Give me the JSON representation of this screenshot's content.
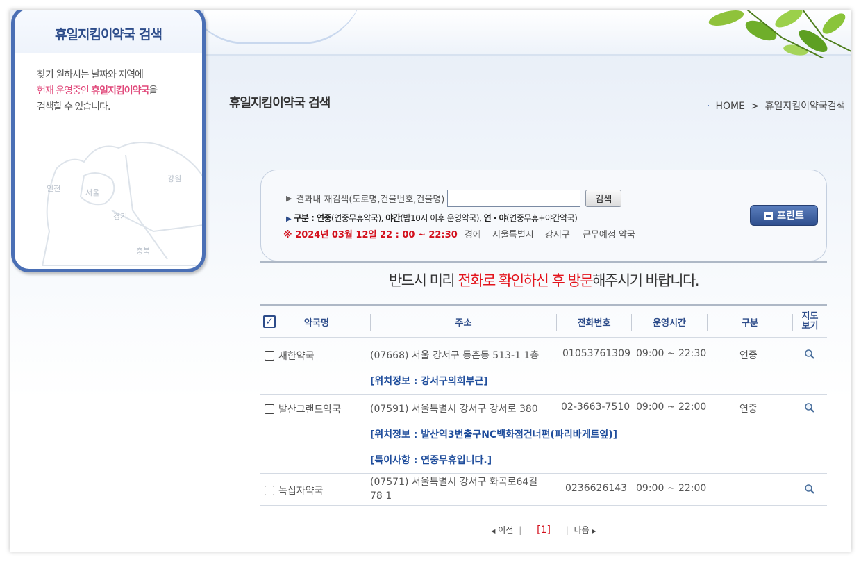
{
  "sidebar": {
    "title": "휴일지킴이약국 검색",
    "desc_line1": "찾기 원하시는 날짜와 지역에",
    "desc_line2_a": "현재 운영중인 ",
    "desc_line2_b": "휴일지킴이약국",
    "desc_line2_c": "을",
    "desc_line3": "검색할 수 있습니다.",
    "map_labels": {
      "incheon": "인천",
      "seoul": "서울",
      "gyeonggi": "경기",
      "gangwon": "강원",
      "chungbuk": "충북"
    }
  },
  "header": {
    "page_title": "휴일지킴이약국 검색",
    "breadcrumb_home": "HOME",
    "breadcrumb_sep": ">",
    "breadcrumb_current": "휴일지킴이약국검색"
  },
  "search": {
    "label": "결과내 재검색(도로명,건물번호,건물명)",
    "input_value": "",
    "button_label": "검색",
    "legend_prefix": "구분 : ",
    "legend_a": "연중",
    "legend_a_desc": "(연중무휴약국), ",
    "legend_b": "야간",
    "legend_b_desc": "(밤10시 이후 운영약국), ",
    "legend_c": "연 · 야",
    "legend_c_desc": "(연중무휴+야간약국)",
    "date_text": "※ 2024년 03월 12일 22 : 00 ~ 22:30",
    "date_suffix": "경에",
    "region_city": "서울특별시",
    "region_district": "강서구",
    "region_suffix": "근무예정 약국",
    "print_label": "프린트"
  },
  "notice": {
    "part1": "반드시 미리 ",
    "part2": "전화로 확인하신 후 방문",
    "part3": "해주시기 바랍니다."
  },
  "table": {
    "headers": {
      "name": "약국명",
      "address": "주소",
      "phone": "전화번호",
      "hours": "운영시간",
      "type": "구분",
      "map_line1": "지도",
      "map_line2": "보기"
    },
    "rows": [
      {
        "name": "새한약국",
        "address": "(07668) 서울 강서구 등촌동 513-1 1층",
        "phone": "01053761309",
        "hours": "09:00 ~ 22:30",
        "type": "연중",
        "info1": "[위치정보 : 강서구의회부근]"
      },
      {
        "name": "발산그랜드약국",
        "address": "(07591) 서울특별시 강서구 강서로 380",
        "phone": "02-3663-7510",
        "hours": "09:00 ~ 22:00",
        "type": "연중",
        "info1": "[위치정보 : 발산역3번출구NC백화점건너편(파리바게트옆)]",
        "info2": "[특이사항 : 연중무휴입니다.]"
      },
      {
        "name": "녹십자약국",
        "address_line1": "(07571) 서울특별시 강서구 화곡로64길",
        "address_line2": "78 1",
        "phone": "0236626143",
        "hours": "09:00 ~ 22:00",
        "type": ""
      }
    ]
  },
  "pager": {
    "prev": "이전",
    "current": "[1]",
    "next": "다음"
  },
  "colors": {
    "brand_blue": "#2d4c8a",
    "accent_red": "#e3141c",
    "accent_pink": "#e0487a",
    "info_blue": "#1f4d9c"
  }
}
